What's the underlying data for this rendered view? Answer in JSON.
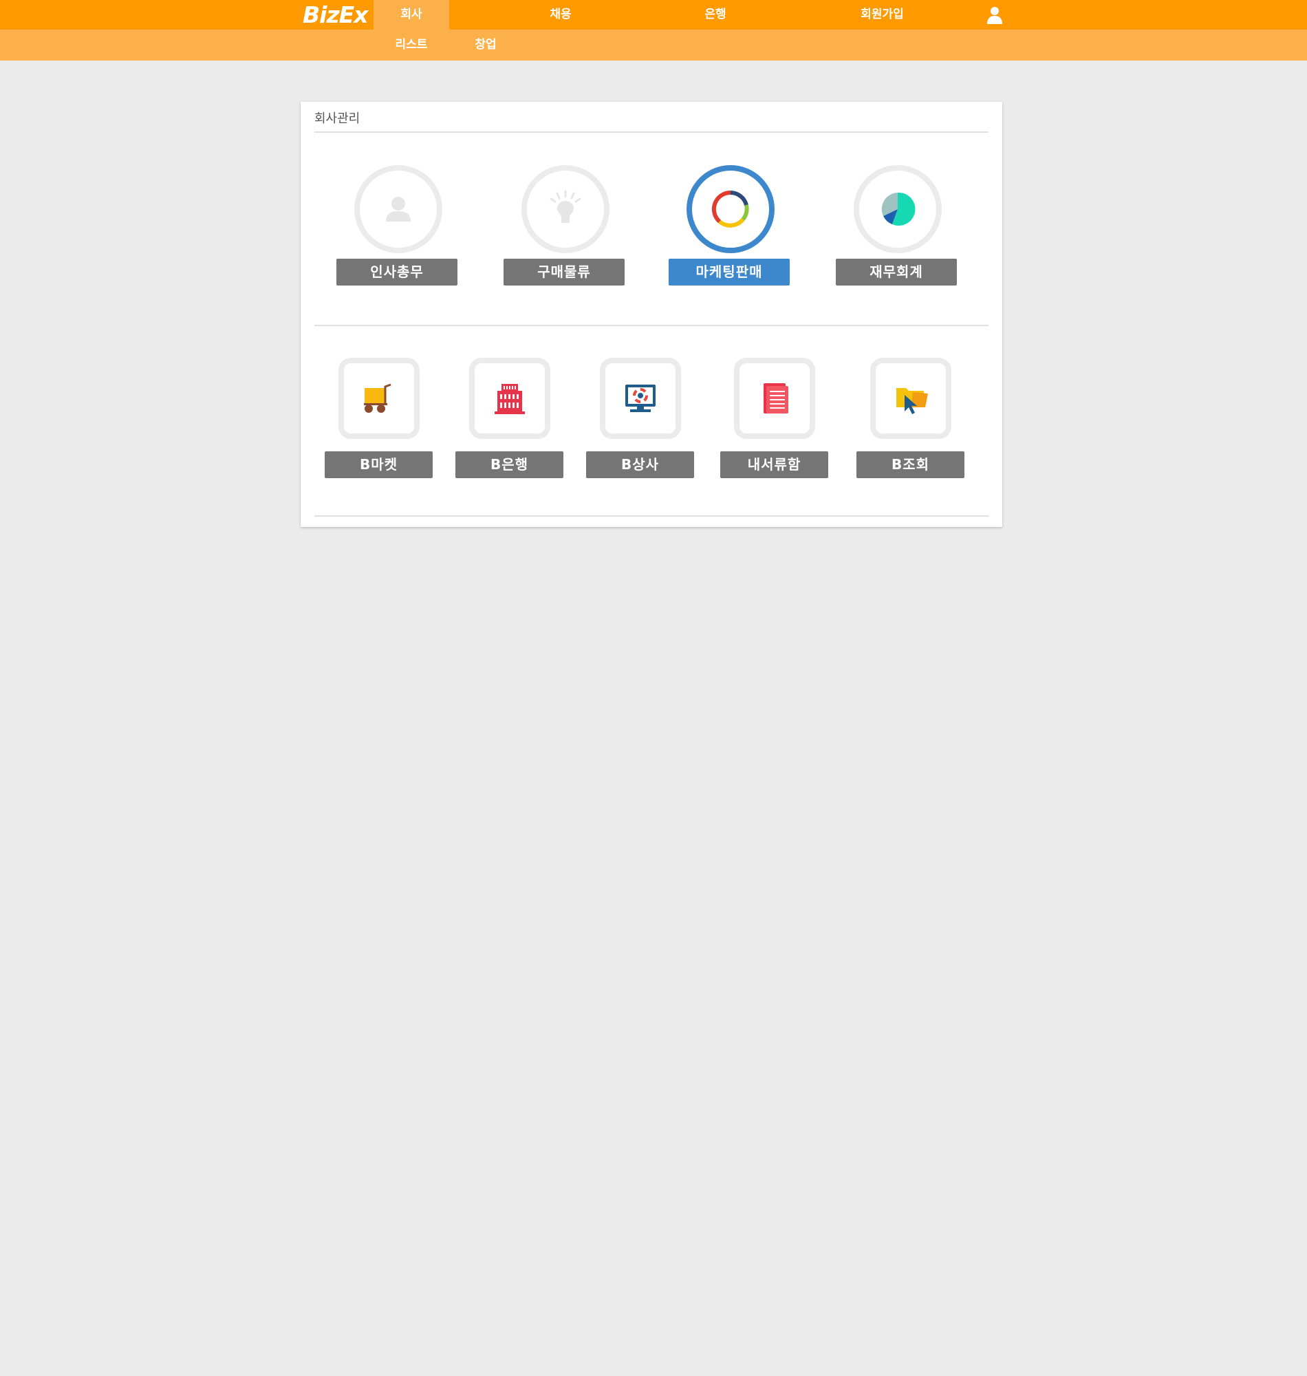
{
  "header": {
    "logo": "BizEx",
    "nav": [
      {
        "label": "회사"
      },
      {
        "label": "채용"
      },
      {
        "label": "은행"
      },
      {
        "label": "회원가입"
      }
    ],
    "subnav": [
      {
        "label": "리스트"
      },
      {
        "label": "창업"
      }
    ],
    "user_icon": "user-icon"
  },
  "panel": {
    "title": "회사관리",
    "departments": [
      {
        "label": "인사총무",
        "icon": "person-icon",
        "active": false
      },
      {
        "label": "구매물류",
        "icon": "lightbulb-icon",
        "active": false
      },
      {
        "label": "마케팅판매",
        "icon": "donut-chart-icon",
        "active": true
      },
      {
        "label": "재무회계",
        "icon": "pie-chart-icon",
        "active": false
      }
    ],
    "services": [
      {
        "label": "B마켓",
        "icon": "cart-icon"
      },
      {
        "label": "B은행",
        "icon": "bank-building-icon"
      },
      {
        "label": "B상사",
        "icon": "monitor-icon"
      },
      {
        "label": "내서류함",
        "icon": "document-icon"
      },
      {
        "label": "B조회",
        "icon": "folder-cursor-icon"
      }
    ]
  },
  "colors": {
    "primary_orange": "#ff9900",
    "sub_orange": "#fcb04a",
    "active_blue": "#3d87cc",
    "button_gray": "#757575",
    "background": "#ebebeb"
  }
}
